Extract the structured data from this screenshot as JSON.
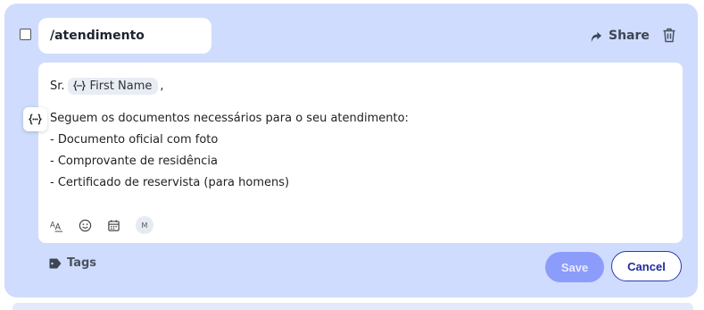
{
  "shortcut": {
    "name": "/atendimento"
  },
  "header": {
    "share_label": "Share"
  },
  "message": {
    "greeting_prefix": "Sr.",
    "variable_chip": "First Name",
    "greeting_suffix": ",",
    "lines": [
      "Seguem os documentos necessários para o seu atendimento:",
      "- Documento oficial com foto",
      "- Comprovante de residência",
      "- Certificado de reservista (para homens)"
    ]
  },
  "toolbar": {
    "mention_badge": "M"
  },
  "footer": {
    "tags_label": "Tags",
    "save_label": "Save",
    "cancel_label": "Cancel"
  },
  "colors": {
    "card_bg": "#cfdcfd",
    "save_bg": "#8c9cfb",
    "cancel_border": "#2b3ab7"
  }
}
